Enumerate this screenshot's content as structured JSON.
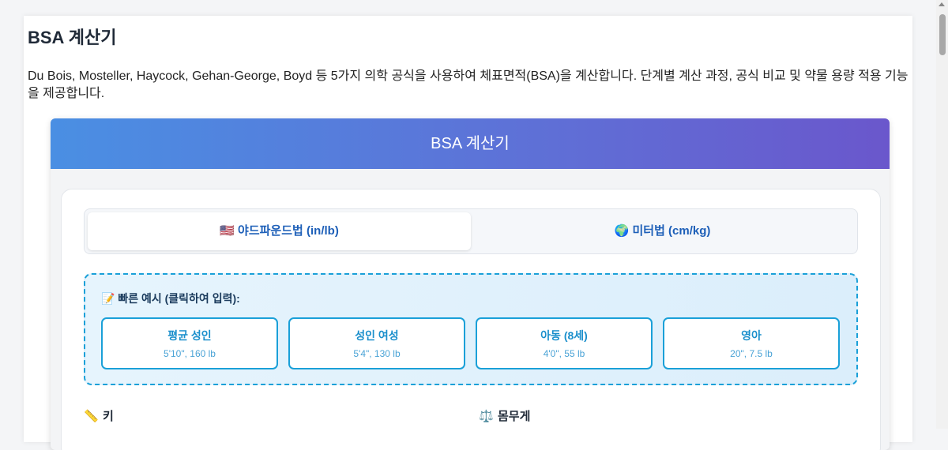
{
  "page": {
    "title": "BSA 계산기",
    "description": "Du Bois, Mosteller, Haycock, Gehan-George, Boyd 등 5가지 의학 공식을 사용하여 체표면적(BSA)을 계산합니다. 단계별 계산 과정, 공식 비교 및 약물 용량 적용 기능을 제공합니다."
  },
  "calculator": {
    "header": "BSA 계산기",
    "unit_tabs": [
      {
        "flag": "🇺🇸",
        "label": "야드파운드법 (in/lb)",
        "active": true
      },
      {
        "flag": "🌍",
        "label": "미터법 (cm/kg)",
        "active": false
      }
    ],
    "examples": {
      "title": "📝 빠른 예시 (클릭하여 입력):",
      "items": [
        {
          "label": "평균 성인",
          "sub": "5'10\", 160 lb"
        },
        {
          "label": "성인 여성",
          "sub": "5'4\", 130 lb"
        },
        {
          "label": "아동 (8세)",
          "sub": "4'0\", 55 lb"
        },
        {
          "label": "영아",
          "sub": "20\", 7.5 lb"
        }
      ]
    },
    "fields": {
      "height_icon": "📏",
      "height_label": "키",
      "weight_icon": "⚖️",
      "weight_label": "몸무게"
    }
  },
  "icons": {
    "height": "ruler-icon",
    "weight": "scale-icon",
    "us_flag": "us-flag-icon",
    "globe": "globe-icon",
    "memo": "memo-icon"
  }
}
